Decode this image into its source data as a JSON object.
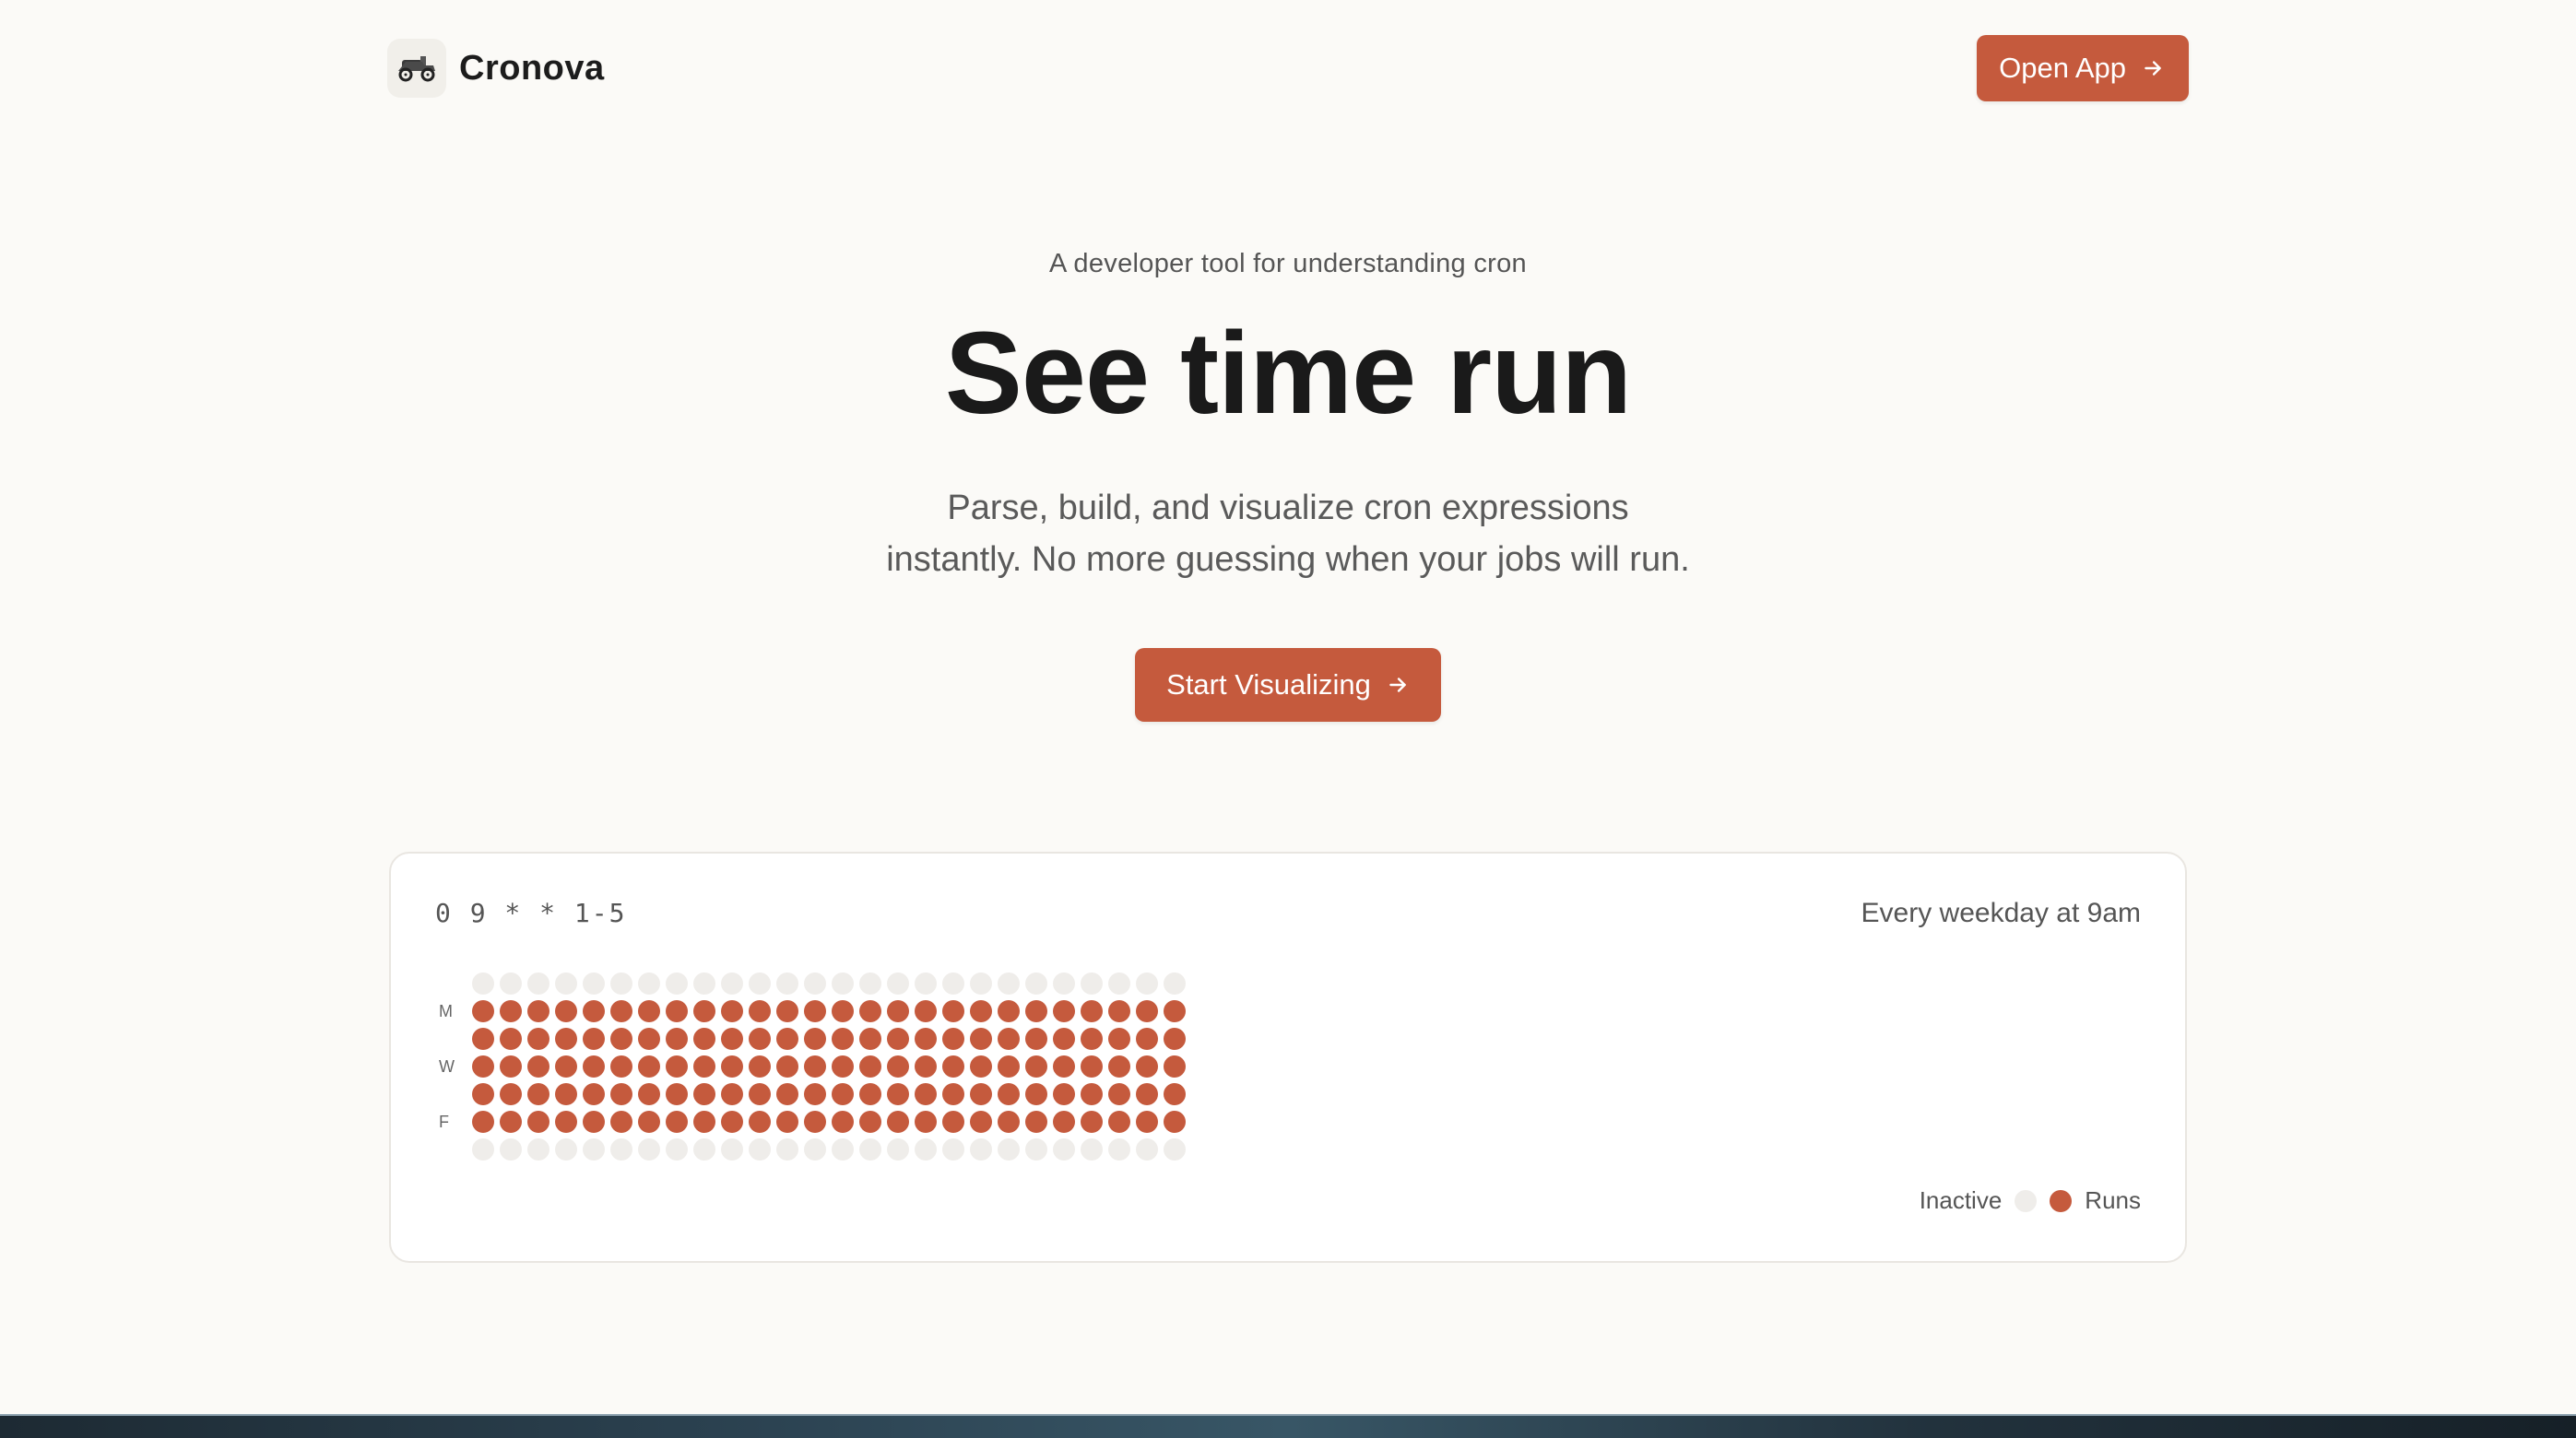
{
  "header": {
    "brand_name": "Cronova",
    "logo_icon": "steam-car-icon",
    "open_app_label": "Open App"
  },
  "hero": {
    "eyebrow": "A developer tool for understanding cron",
    "headline": "See time run",
    "subtext_line1": "Parse, build, and visualize cron expressions",
    "subtext_line2": "instantly. No more guessing when your jobs will run.",
    "cta_label": "Start Visualizing"
  },
  "preview": {
    "expression": "0 9 * * 1-5",
    "description": "Every weekday at 9am",
    "day_labels": [
      "",
      "M",
      "",
      "W",
      "",
      "F",
      ""
    ],
    "columns": 26,
    "active_rows": [
      false,
      true,
      true,
      true,
      true,
      true,
      false
    ],
    "legend_inactive": "Inactive",
    "legend_runs": "Runs"
  },
  "colors": {
    "accent": "#c55a3d",
    "inactive_dot": "#efedea",
    "background": "#fbfaf7"
  }
}
